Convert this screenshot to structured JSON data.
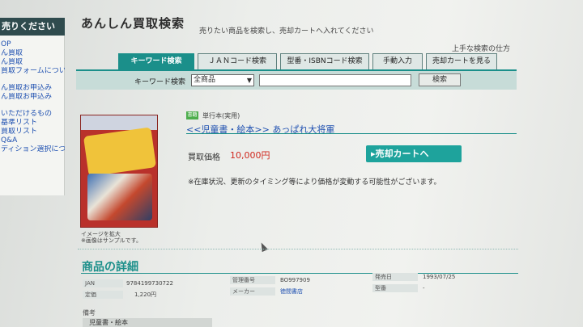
{
  "sidebar": {
    "header": "売りください",
    "items": [
      "OP",
      "ん買取",
      "ん買取",
      "買取フォームについ",
      "ん買取お申込み",
      "ん買取お申込み",
      "いただけるもの",
      "基準リスト",
      "買取リスト",
      "Q&A",
      "ディション選択について"
    ]
  },
  "header": {
    "title": "あんしん買取検索",
    "subtitle": "売りたい商品を検索し、売却カートへ入れてください",
    "tips_link": "上手な検索の仕方"
  },
  "tabs": [
    {
      "label": "キーワード検索",
      "active": true
    },
    {
      "label": "ＪＡＮコード検索",
      "active": false
    },
    {
      "label": "型番・ISBNコード検索",
      "active": false
    },
    {
      "label": "手動入力",
      "active": false
    },
    {
      "label": "売却カートを見る",
      "active": false
    }
  ],
  "search": {
    "label": "キーワード検索",
    "category": "全商品",
    "keyword": "",
    "button": "検索"
  },
  "product": {
    "image_caption_1": "イメージを拡大",
    "image_caption_2": "※画像はサンプルです。",
    "badge": "書籍",
    "binding": "単行本(実用)",
    "title": "<<児童書・絵本>> あっぱれ大将軍",
    "price_label": "買取価格",
    "price": "10,000円",
    "cart_button": "▸売却カートへ",
    "notice": "※在庫状況、更新のタイミング等により価格が変動する可能性がございます。"
  },
  "details": {
    "heading": "商品の詳細",
    "jan_label": "JAN",
    "jan_value": "9784199730722",
    "list_price_label": "定価",
    "list_price_value": "1,220円",
    "control_no_label": "管理番号",
    "control_no_value": "BO997909",
    "maker_label": "メーカー",
    "maker_value": "徳間書店",
    "release_label": "発売日",
    "release_value": "1993/07/25",
    "model_label": "型番",
    "model_value": "-",
    "remarks_label": "備考",
    "remarks_value": "児童書・絵本"
  },
  "colors": {
    "accent": "#1b8f8a",
    "price": "#d0281e",
    "link": "#1d4fb0"
  }
}
